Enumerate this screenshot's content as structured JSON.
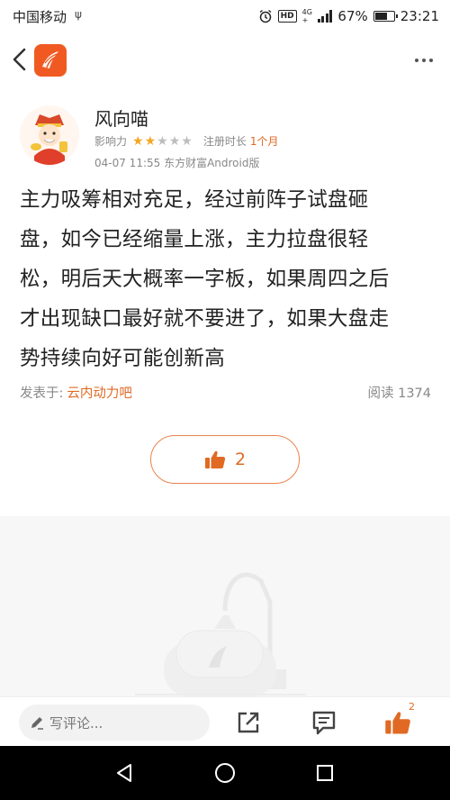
{
  "status_bar": {
    "carrier": "中国移动",
    "usb_glyph": "ψ",
    "hd": "HD",
    "network_top": "4G",
    "network_bottom": "+",
    "battery_percent": "67%",
    "battery_level": 0.67,
    "time": "23:21"
  },
  "header": {
    "back_icon": "chevron-left-icon",
    "logo_icon": "eastmoney-logo-icon",
    "more_icon": "more-dots-icon"
  },
  "author": {
    "name": "风向喵",
    "influence_label": "影响力",
    "influence_stars": 2,
    "influence_max": 5,
    "registered_label": "注册时长",
    "registered_value": "1个月",
    "post_meta": "04-07 11:55 东方财富Android版"
  },
  "post": {
    "lines": [
      "主力吸筹相对充足，经过前阵子试盘砸",
      "盘，如今已经缩量上涨，主力拉盘很轻",
      "松，明后天大概率一字板，如果周四之后",
      "才出现缺口最好就不要进了，如果大盘走",
      "势持续向好可能创新高"
    ]
  },
  "footer": {
    "posted_in_label": "发表于:",
    "bar_name": "云内动力吧",
    "read_label": "阅读 1374"
  },
  "like": {
    "count": "2"
  },
  "bottom_bar": {
    "comment_placeholder": "写评论...",
    "like_badge": "2"
  },
  "colors": {
    "accent": "#e06a23",
    "brand": "#f05a22",
    "star": "#f5a623"
  }
}
